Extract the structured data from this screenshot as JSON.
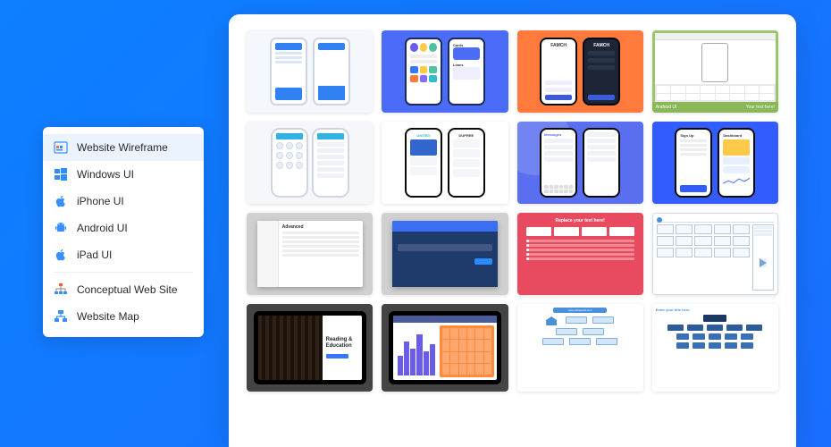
{
  "sidebar": {
    "items": [
      {
        "label": "Website Wireframe",
        "icon": "browser-grid-icon",
        "active": true
      },
      {
        "label": "Windows UI",
        "icon": "windows-icon",
        "active": false
      },
      {
        "label": "iPhone UI",
        "icon": "apple-icon",
        "active": false
      },
      {
        "label": "Android UI",
        "icon": "android-icon",
        "active": false
      },
      {
        "label": "iPad UI",
        "icon": "apple-icon",
        "active": false
      }
    ],
    "items2": [
      {
        "label": "Conceptual Web Site",
        "icon": "sitemap-color-icon"
      },
      {
        "label": "Website Map",
        "icon": "hierarchy-icon"
      }
    ]
  },
  "gallery": {
    "thumbs": [
      {
        "kind": "mobile-app-blue-charts"
      },
      {
        "kind": "mobile-app-cards-loans",
        "labels": [
          "Cards",
          "Loans"
        ]
      },
      {
        "kind": "mobile-login-famch",
        "brand": "FAMCH"
      },
      {
        "kind": "android-ui-keyboard",
        "caption": "Android UI"
      },
      {
        "kind": "mobile-dialer-list"
      },
      {
        "kind": "mobile-shop-list",
        "brands": [
          "UNITED",
          "DUPREE"
        ]
      },
      {
        "kind": "mobile-messages",
        "title": "Messages"
      },
      {
        "kind": "mobile-dashboard-signup",
        "labels": [
          "Sign Up",
          "Dashboard"
        ]
      },
      {
        "kind": "macos-advanced-settings",
        "title": "Advanced"
      },
      {
        "kind": "windows-blue-dialog"
      },
      {
        "kind": "red-replace-text",
        "title": "Replace your text here!"
      },
      {
        "kind": "wireframe-grid-player"
      },
      {
        "kind": "ipad-reading-education",
        "title": "Reading & Education"
      },
      {
        "kind": "ipad-analytics-calendar"
      },
      {
        "kind": "sitemap-diagram",
        "url": "www.edrawsoft.com"
      },
      {
        "kind": "website-map-tree",
        "title": "Enter your title here"
      }
    ]
  }
}
